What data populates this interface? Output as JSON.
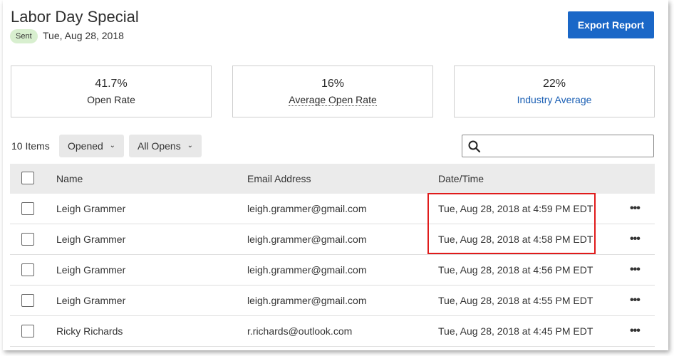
{
  "campaign": {
    "title": "Labor Day Special",
    "status_badge": "Sent",
    "sent_date": "Tue, Aug 28, 2018",
    "export_label": "Export Report"
  },
  "stats": [
    {
      "value": "41.7%",
      "label": "Open Rate"
    },
    {
      "value": "16%",
      "label": "Average Open Rate"
    },
    {
      "value": "22%",
      "label": "Industry Average"
    }
  ],
  "toolbar": {
    "item_count": "10 Items",
    "filter1": "Opened",
    "filter2": "All Opens",
    "search_placeholder": "",
    "search_icon": "search-icon"
  },
  "table": {
    "columns": [
      "Name",
      "Email Address",
      "Date/Time"
    ],
    "rows": [
      {
        "name": "Leigh Grammer",
        "email": "leigh.grammer@gmail.com",
        "datetime": "Tue, Aug 28, 2018 at 4:59 PM EDT"
      },
      {
        "name": "Leigh Grammer",
        "email": "leigh.grammer@gmail.com",
        "datetime": "Tue, Aug 28, 2018 at 4:58 PM EDT"
      },
      {
        "name": "Leigh Grammer",
        "email": "leigh.grammer@gmail.com",
        "datetime": "Tue, Aug 28, 2018 at 4:56 PM EDT"
      },
      {
        "name": "Leigh Grammer",
        "email": "leigh.grammer@gmail.com",
        "datetime": "Tue, Aug 28, 2018 at 4:55 PM EDT"
      },
      {
        "name": "Ricky Richards",
        "email": "r.richards@outlook.com",
        "datetime": "Tue, Aug 28, 2018 at 4:45 PM EDT"
      }
    ]
  },
  "colors": {
    "accent": "#1a67c7",
    "badge_bg": "#d8efcf",
    "highlight": "#e01b1b",
    "link": "#1a5fb4"
  }
}
